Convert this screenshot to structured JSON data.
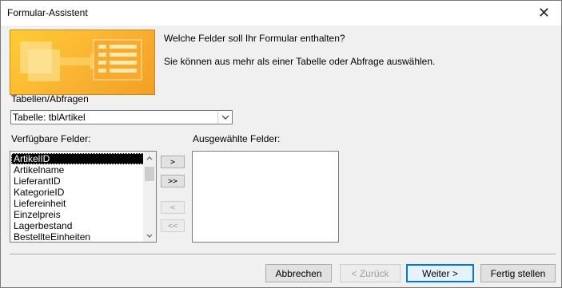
{
  "window": {
    "title": "Formular-Assistent",
    "close_glyph": "✕"
  },
  "prompt": {
    "line1": "Welche Felder soll Ihr Formular enthalten?",
    "line2": "Sie können aus mehr als einer Tabelle oder Abfrage auswählen."
  },
  "source": {
    "label": "Tabellen/Abfragen",
    "selected": "Tabelle: tblArtikel"
  },
  "available": {
    "label": "Verfügbare Felder:",
    "items": [
      "ArtikelID",
      "Artikelname",
      "LieferantID",
      "KategorieID",
      "Liefereinheit",
      "Einzelpreis",
      "Lagerbestand",
      "BestellteEinheiten"
    ],
    "selected_index": 0
  },
  "selected_fields": {
    "label": "Ausgewählte Felder:",
    "items": []
  },
  "move": {
    "add_one": ">",
    "add_all": ">>",
    "remove_one": "<",
    "remove_all": "<<"
  },
  "buttons": {
    "cancel": "Abbrechen",
    "back": "< Zurück",
    "next": "Weiter >",
    "finish": "Fertig stellen"
  },
  "colors": {
    "accent": "#0078d7",
    "banner": "#f9b233",
    "selection": "#000000"
  }
}
